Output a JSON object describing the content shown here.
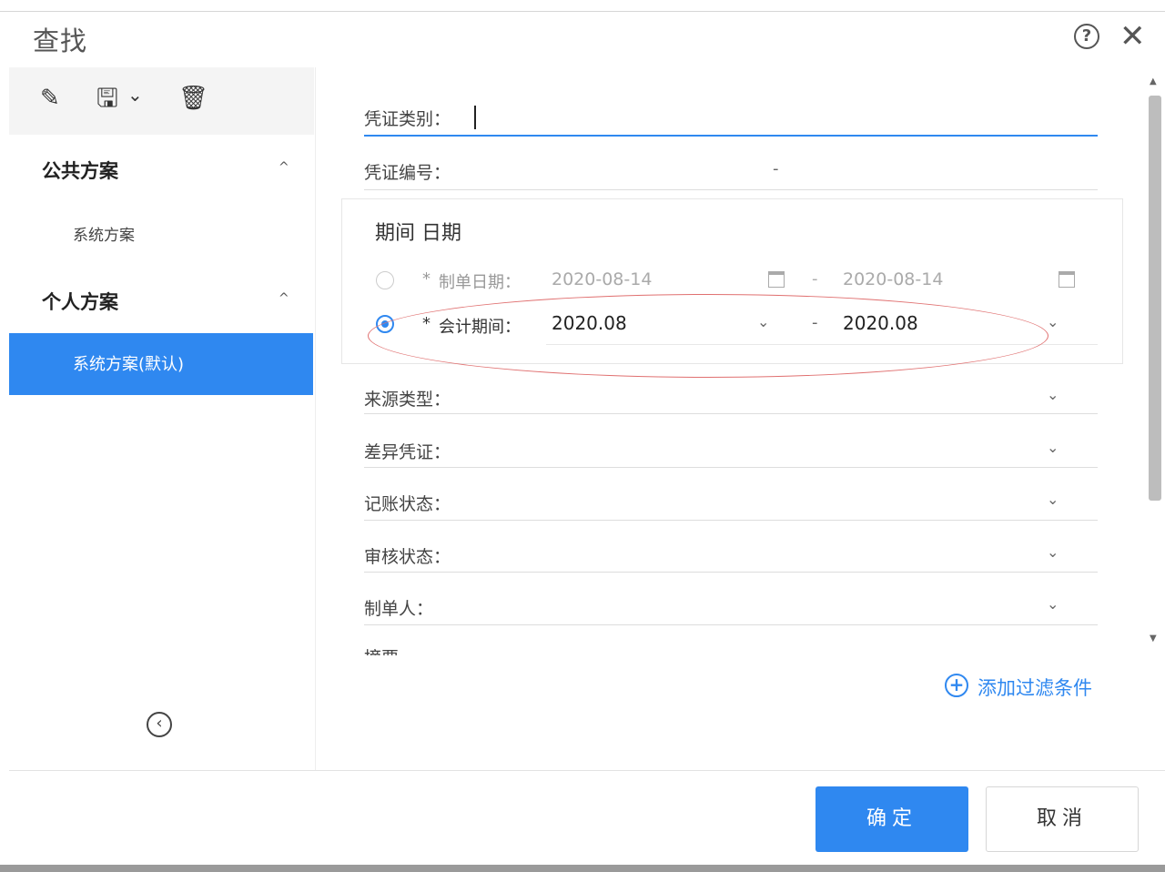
{
  "dialog": {
    "title": "查找",
    "help_glyph": "?",
    "close_glyph": "✕"
  },
  "toolbar": {
    "edit_icon": "✎",
    "save_icon": "🖫",
    "save_caret": "⌄",
    "delete_icon": "🗑"
  },
  "sidebar": {
    "public_group": "公共方案",
    "public_items": [
      "系统方案"
    ],
    "personal_group": "个人方案",
    "personal_items": [
      "系统方案(默认)"
    ],
    "group_caret": "^",
    "collapse_glyph": "‹"
  },
  "filters": {
    "voucher_type_label": "凭证类别：",
    "voucher_no_label": "凭证编号：",
    "voucher_no_sep": "-",
    "source_type_label": "来源类型：",
    "diff_voucher_label": "差异凭证：",
    "posting_status_label": "记账状态：",
    "audit_status_label": "审核状态：",
    "preparer_label": "制单人：",
    "cutoff_label": "摘要",
    "chevron": "⌄"
  },
  "period": {
    "title": "期间 日期",
    "date_row": {
      "selected": false,
      "required_mark": "*",
      "label": "制单日期：",
      "from": "2020-08-14",
      "to": "2020-08-14",
      "sep": "-"
    },
    "period_row": {
      "selected": true,
      "required_mark": "*",
      "label": "会计期间：",
      "from": "2020.08",
      "to": "2020.08",
      "sep": "-"
    }
  },
  "add_filter": {
    "icon": "+",
    "label": "添加过滤条件"
  },
  "footer": {
    "ok_label": "确定",
    "cancel_label": "取消"
  },
  "colors": {
    "accent": "#2f88f0",
    "annotation": "#e07070"
  }
}
